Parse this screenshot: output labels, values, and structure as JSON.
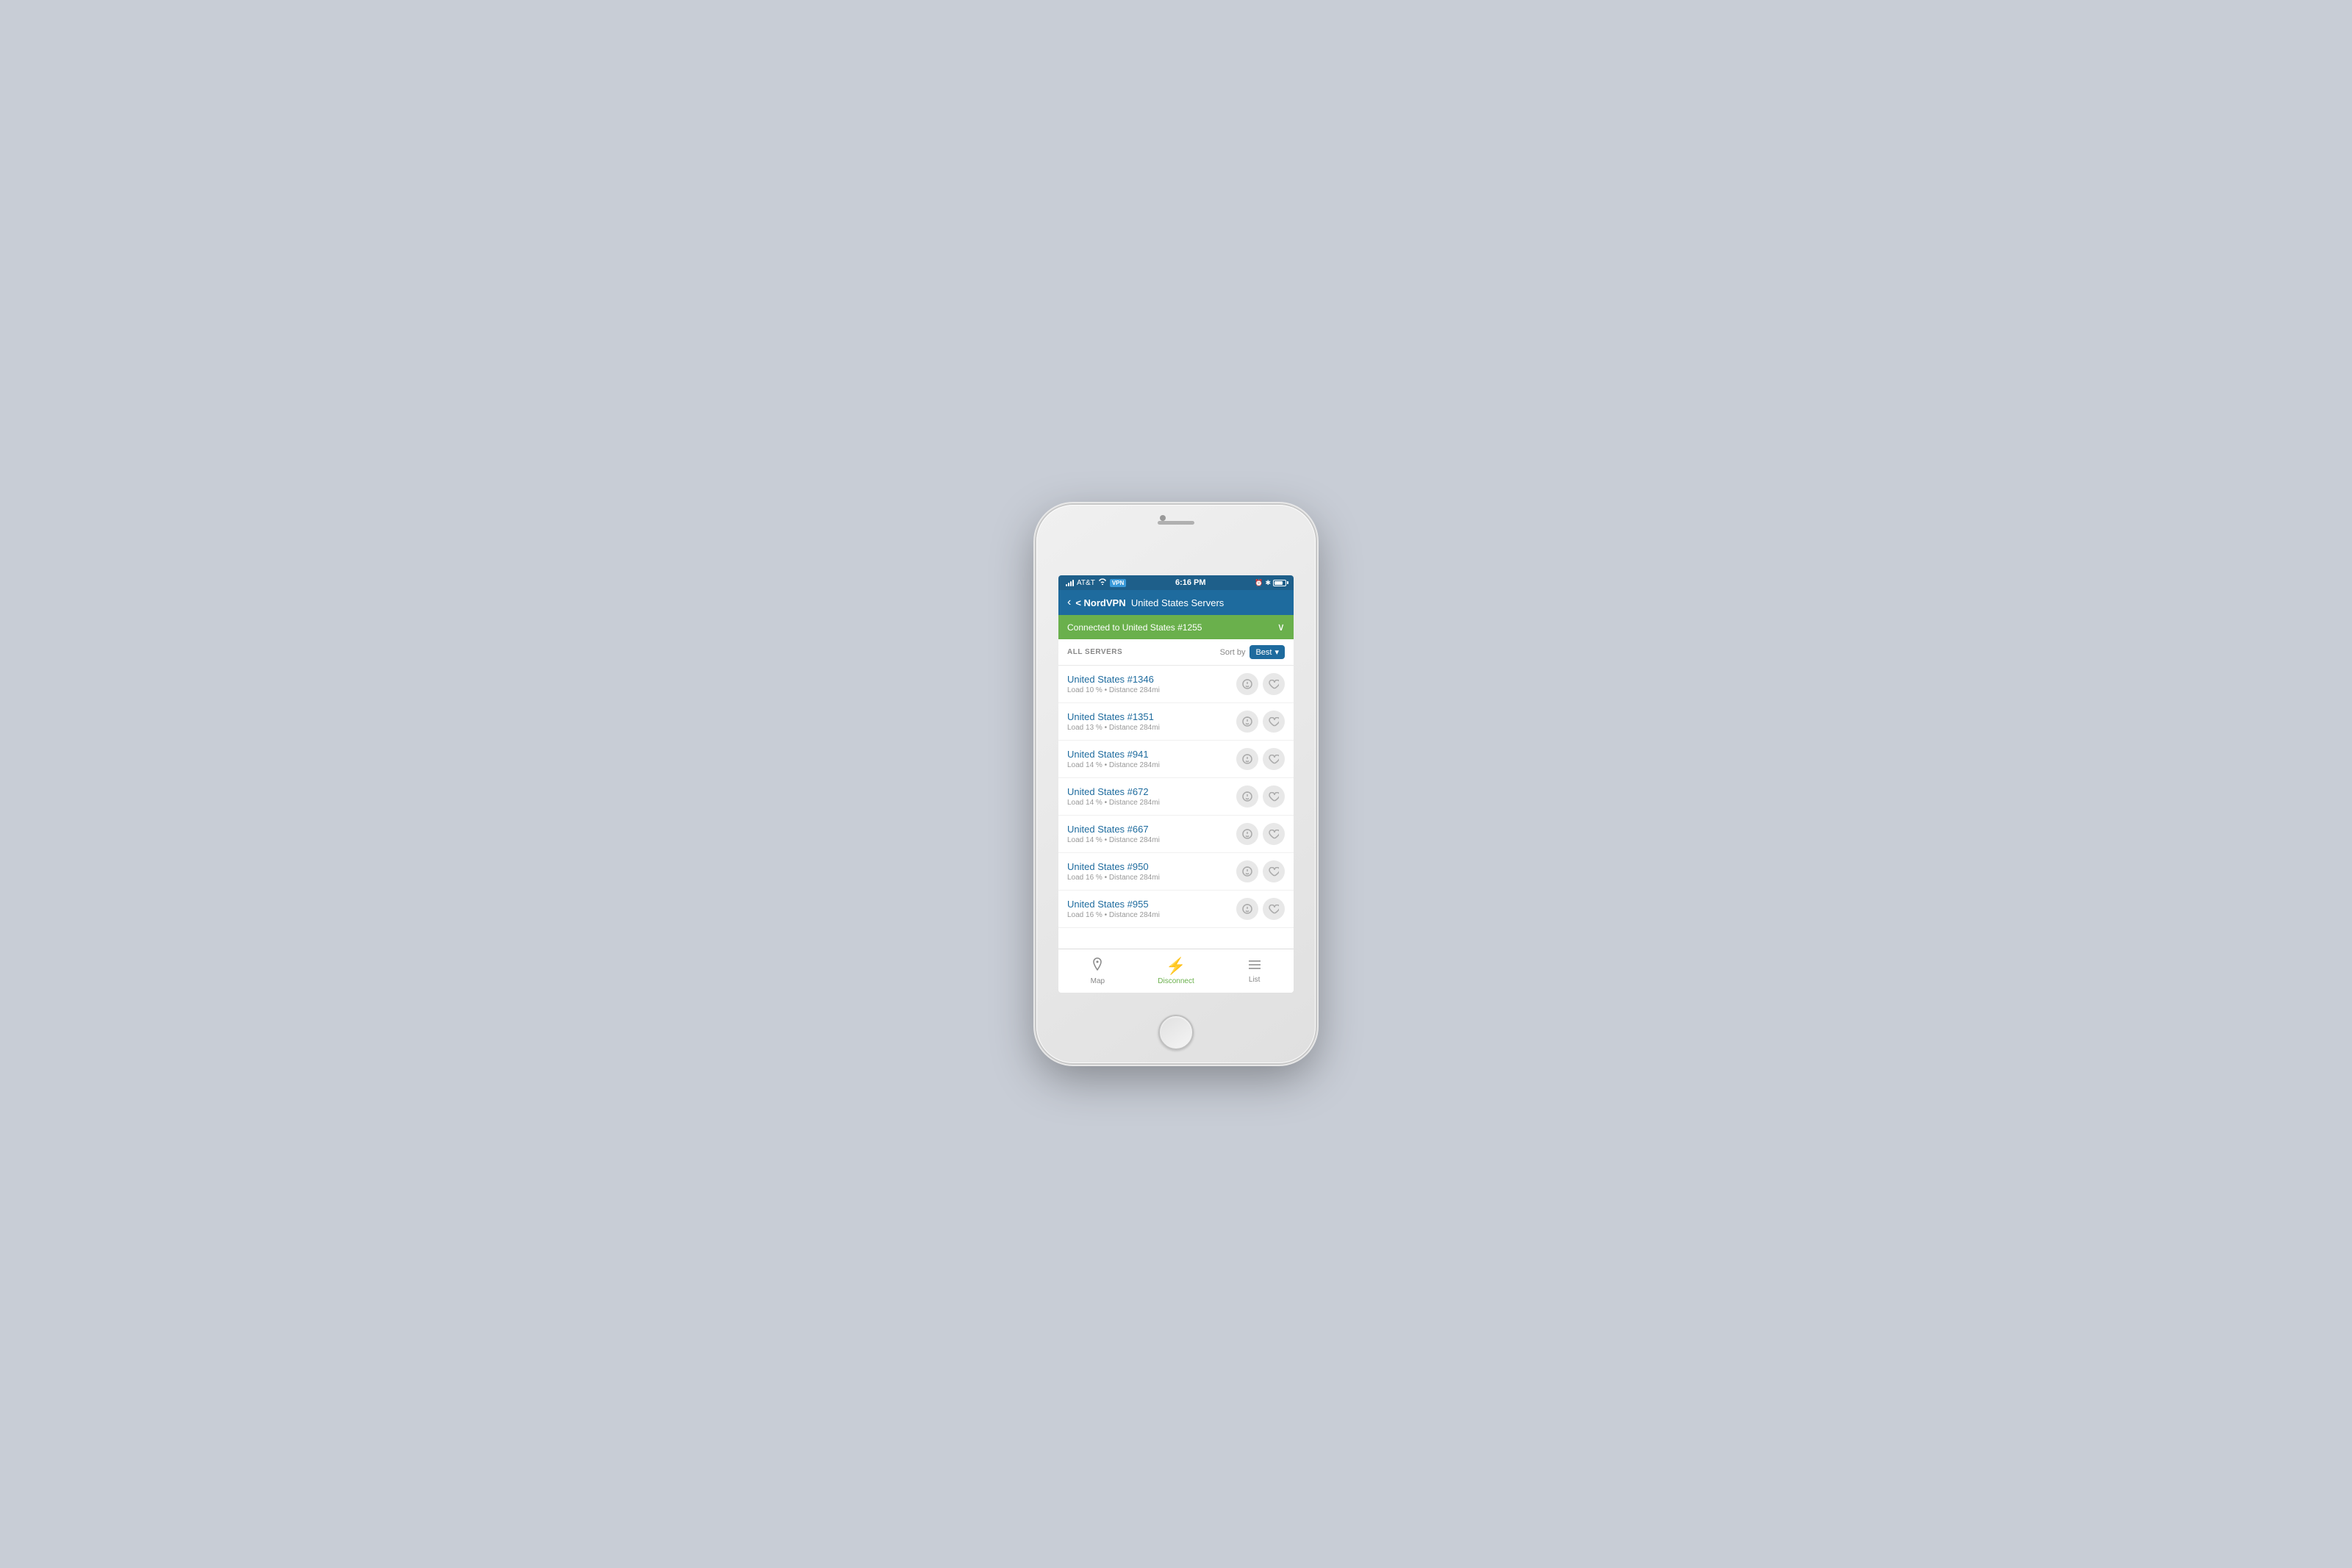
{
  "phone": {
    "status_bar": {
      "carrier": "AT&T",
      "wifi": "wifi",
      "vpn": "VPN",
      "time": "6:16 PM",
      "alarm": "alarm",
      "bluetooth": "bluetooth",
      "battery": "battery"
    },
    "nav": {
      "back_label": "< NordVPN",
      "title": "United States Servers"
    },
    "connected_banner": {
      "text": "Connected to United States #1255",
      "chevron": "∨"
    },
    "list_header": {
      "title": "ALL SERVERS",
      "sort_label": "Sort by",
      "sort_value": "Best"
    },
    "servers": [
      {
        "name": "United States #1346",
        "load": "Load 10 %",
        "distance": "Distance 284mi"
      },
      {
        "name": "United States #1351",
        "load": "Load 13 %",
        "distance": "Distance 284mi"
      },
      {
        "name": "United States #941",
        "load": "Load 14 %",
        "distance": "Distance 284mi"
      },
      {
        "name": "United States #672",
        "load": "Load 14 %",
        "distance": "Distance 284mi"
      },
      {
        "name": "United States #667",
        "load": "Load 14 %",
        "distance": "Distance 284mi"
      },
      {
        "name": "United States #950",
        "load": "Load 16 %",
        "distance": "Distance 284mi"
      },
      {
        "name": "United States #955",
        "load": "Load 16 %",
        "distance": "Distance 284mi"
      }
    ],
    "tabs": [
      {
        "id": "map",
        "label": "Map",
        "icon": "📍",
        "active": false
      },
      {
        "id": "disconnect",
        "label": "Disconnect",
        "icon": "⚡",
        "active": true
      },
      {
        "id": "list",
        "label": "List",
        "icon": "☰",
        "active": false
      }
    ]
  }
}
